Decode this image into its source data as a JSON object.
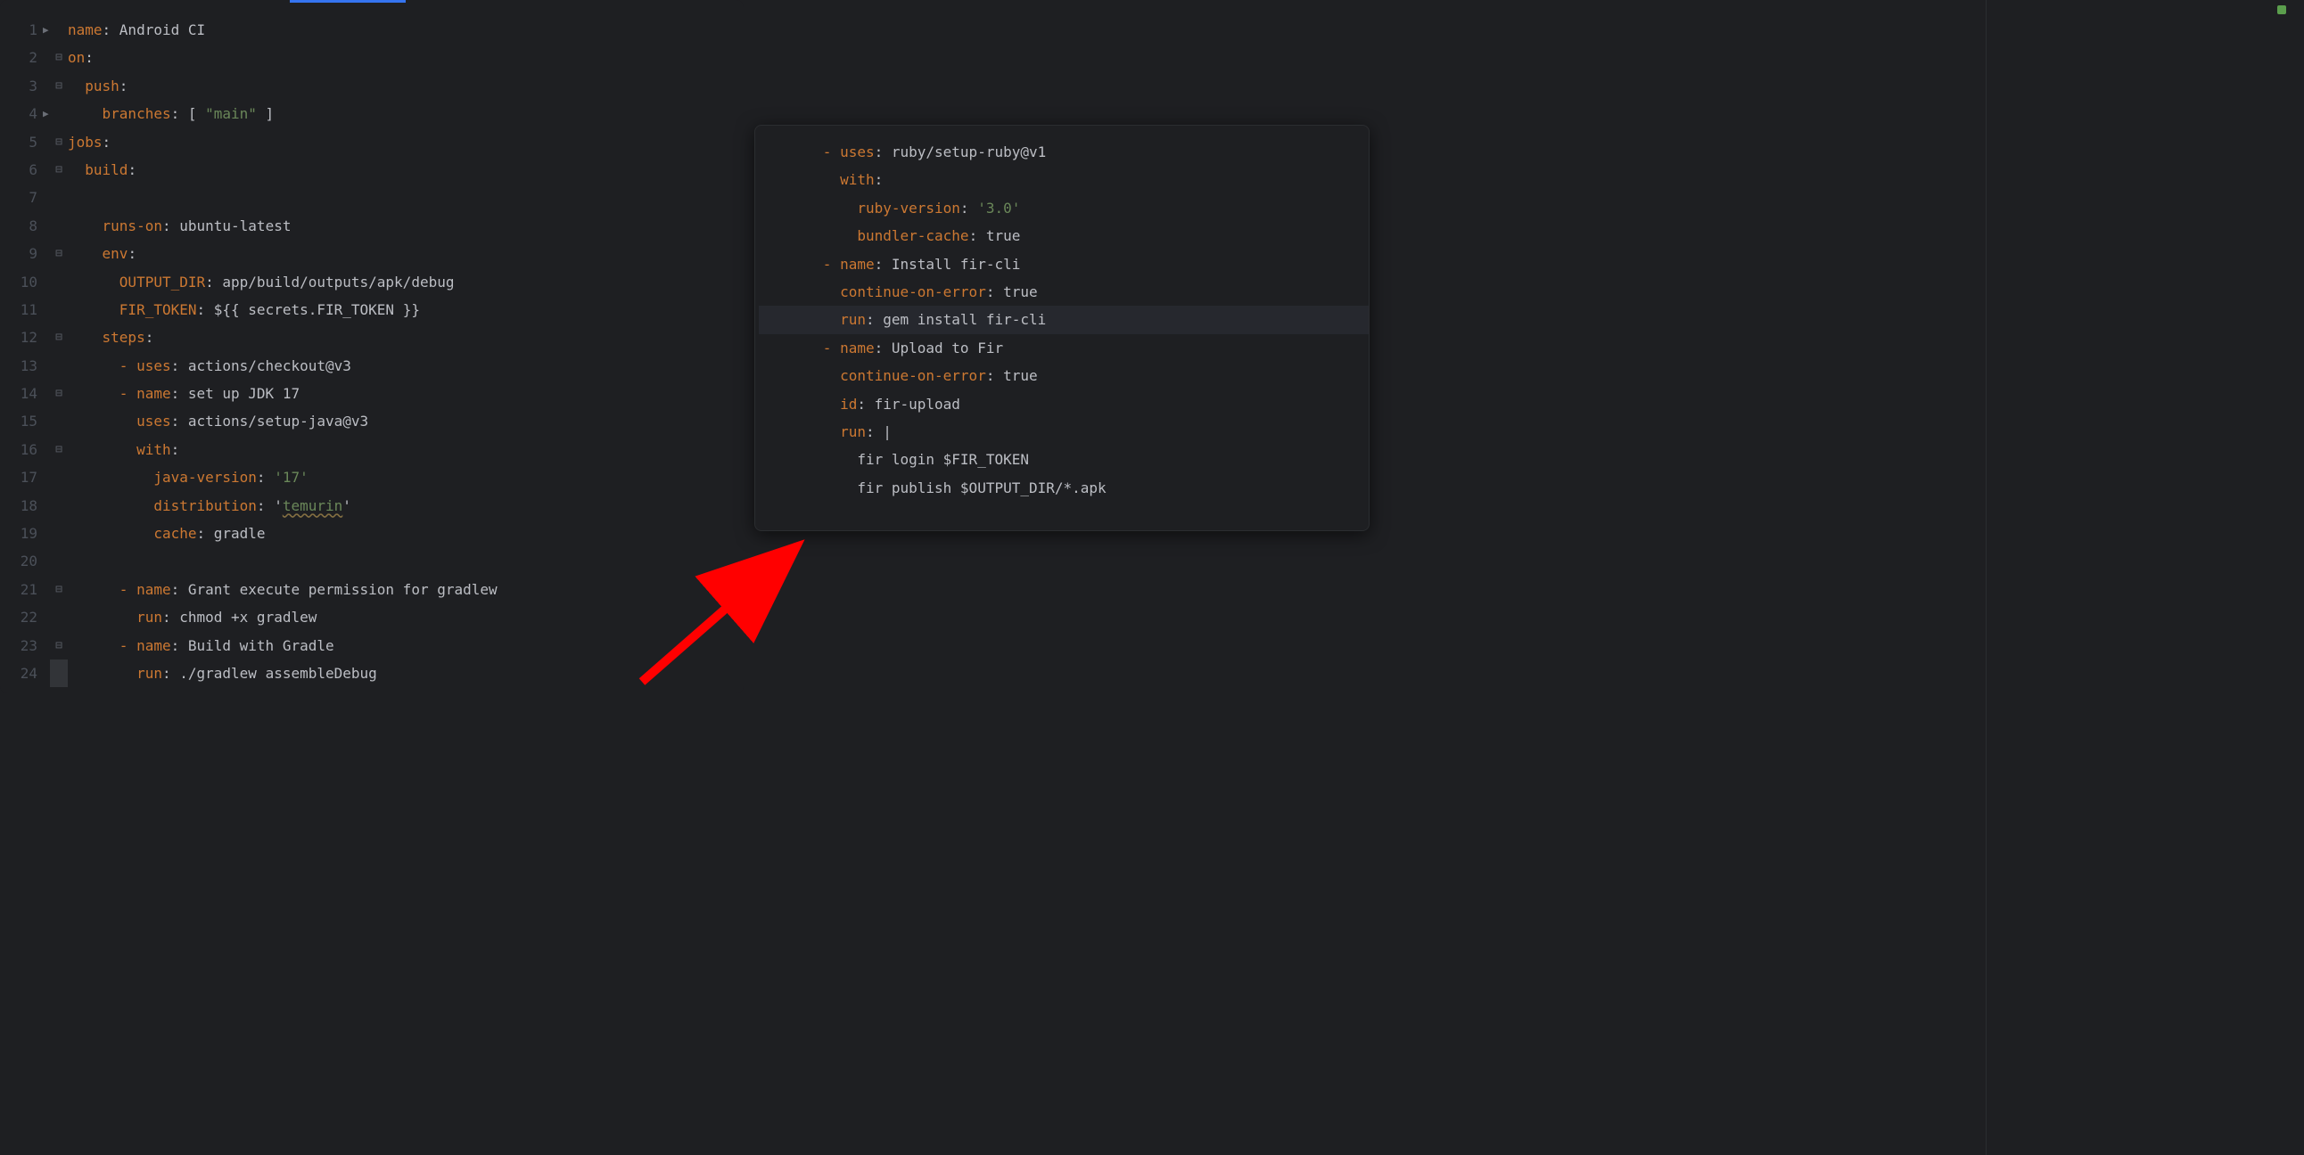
{
  "left": {
    "lines": [
      {
        "n": "1",
        "fold": "tri",
        "tokens": [
          {
            "c": "tk-key",
            "t": "name"
          },
          {
            "c": "tk-pun",
            "t": ": "
          },
          {
            "c": "tk-txt",
            "t": "Android CI"
          }
        ]
      },
      {
        "n": "2",
        "fold": "minus",
        "tokens": [
          {
            "c": "tk-key",
            "t": "on"
          },
          {
            "c": "tk-pun",
            "t": ":"
          }
        ]
      },
      {
        "n": "3",
        "fold": "minus",
        "tokens": [
          {
            "c": "tk-txt",
            "t": "  "
          },
          {
            "c": "tk-key",
            "t": "push"
          },
          {
            "c": "tk-pun",
            "t": ":"
          }
        ]
      },
      {
        "n": "4",
        "fold": "tri",
        "tokens": [
          {
            "c": "tk-txt",
            "t": "    "
          },
          {
            "c": "tk-key",
            "t": "branches"
          },
          {
            "c": "tk-pun",
            "t": ": [ "
          },
          {
            "c": "tk-str",
            "t": "\"main\""
          },
          {
            "c": "tk-pun",
            "t": " ]"
          }
        ]
      },
      {
        "n": "5",
        "fold": "minus",
        "tokens": [
          {
            "c": "tk-key",
            "t": "jobs"
          },
          {
            "c": "tk-pun",
            "t": ":"
          }
        ]
      },
      {
        "n": "6",
        "fold": "minus",
        "tokens": [
          {
            "c": "tk-txt",
            "t": "  "
          },
          {
            "c": "tk-key",
            "t": "build"
          },
          {
            "c": "tk-pun",
            "t": ":"
          }
        ]
      },
      {
        "n": "7",
        "fold": "",
        "tokens": []
      },
      {
        "n": "8",
        "fold": "",
        "tokens": [
          {
            "c": "tk-txt",
            "t": "    "
          },
          {
            "c": "tk-key",
            "t": "runs-on"
          },
          {
            "c": "tk-pun",
            "t": ": "
          },
          {
            "c": "tk-txt",
            "t": "ubuntu-latest"
          }
        ]
      },
      {
        "n": "9",
        "fold": "minus",
        "tokens": [
          {
            "c": "tk-txt",
            "t": "    "
          },
          {
            "c": "tk-key",
            "t": "env"
          },
          {
            "c": "tk-pun",
            "t": ":"
          }
        ]
      },
      {
        "n": "10",
        "fold": "",
        "tokens": [
          {
            "c": "tk-txt",
            "t": "      "
          },
          {
            "c": "tk-key",
            "t": "OUTPUT_DIR"
          },
          {
            "c": "tk-pun",
            "t": ": "
          },
          {
            "c": "tk-txt",
            "t": "app/build/outputs/apk/debug"
          }
        ]
      },
      {
        "n": "11",
        "fold": "",
        "tokens": [
          {
            "c": "tk-txt",
            "t": "      "
          },
          {
            "c": "tk-key",
            "t": "FIR_TOKEN"
          },
          {
            "c": "tk-pun",
            "t": ": "
          },
          {
            "c": "tk-txt",
            "t": "${{ secrets.FIR_TOKEN }}"
          }
        ]
      },
      {
        "n": "12",
        "fold": "minus",
        "tokens": [
          {
            "c": "tk-txt",
            "t": "    "
          },
          {
            "c": "tk-key",
            "t": "steps"
          },
          {
            "c": "tk-pun",
            "t": ":"
          }
        ]
      },
      {
        "n": "13",
        "fold": "",
        "tokens": [
          {
            "c": "tk-txt",
            "t": "      "
          },
          {
            "c": "tk-dash",
            "t": "- "
          },
          {
            "c": "tk-key",
            "t": "uses"
          },
          {
            "c": "tk-pun",
            "t": ": "
          },
          {
            "c": "tk-txt",
            "t": "actions/checkout@v3"
          }
        ]
      },
      {
        "n": "14",
        "fold": "minus",
        "tokens": [
          {
            "c": "tk-txt",
            "t": "      "
          },
          {
            "c": "tk-dash",
            "t": "- "
          },
          {
            "c": "tk-key",
            "t": "name"
          },
          {
            "c": "tk-pun",
            "t": ": "
          },
          {
            "c": "tk-txt",
            "t": "set up JDK 17"
          }
        ]
      },
      {
        "n": "15",
        "fold": "",
        "tokens": [
          {
            "c": "tk-txt",
            "t": "        "
          },
          {
            "c": "tk-key",
            "t": "uses"
          },
          {
            "c": "tk-pun",
            "t": ": "
          },
          {
            "c": "tk-txt",
            "t": "actions/setup-java@v3"
          }
        ]
      },
      {
        "n": "16",
        "fold": "minus",
        "tokens": [
          {
            "c": "tk-txt",
            "t": "        "
          },
          {
            "c": "tk-key",
            "t": "with"
          },
          {
            "c": "tk-pun",
            "t": ":"
          }
        ]
      },
      {
        "n": "17",
        "fold": "",
        "tokens": [
          {
            "c": "tk-txt",
            "t": "          "
          },
          {
            "c": "tk-key",
            "t": "java-version"
          },
          {
            "c": "tk-pun",
            "t": ": "
          },
          {
            "c": "tk-str",
            "t": "'17'"
          }
        ]
      },
      {
        "n": "18",
        "fold": "",
        "tokens": [
          {
            "c": "tk-txt",
            "t": "          "
          },
          {
            "c": "tk-key",
            "t": "distribution"
          },
          {
            "c": "tk-pun",
            "t": ": '"
          },
          {
            "c": "tk-warn",
            "t": "temurin"
          },
          {
            "c": "tk-pun",
            "t": "'"
          }
        ]
      },
      {
        "n": "19",
        "fold": "",
        "tokens": [
          {
            "c": "tk-txt",
            "t": "          "
          },
          {
            "c": "tk-key",
            "t": "cache"
          },
          {
            "c": "tk-pun",
            "t": ": "
          },
          {
            "c": "tk-txt",
            "t": "gradle"
          }
        ]
      },
      {
        "n": "20",
        "fold": "",
        "tokens": []
      },
      {
        "n": "21",
        "fold": "minus",
        "tokens": [
          {
            "c": "tk-txt",
            "t": "      "
          },
          {
            "c": "tk-dash",
            "t": "- "
          },
          {
            "c": "tk-key",
            "t": "name"
          },
          {
            "c": "tk-pun",
            "t": ": "
          },
          {
            "c": "tk-txt",
            "t": "Grant execute permission for gradlew"
          }
        ]
      },
      {
        "n": "22",
        "fold": "",
        "tokens": [
          {
            "c": "tk-txt",
            "t": "        "
          },
          {
            "c": "tk-key",
            "t": "run"
          },
          {
            "c": "tk-pun",
            "t": ": "
          },
          {
            "c": "tk-txt",
            "t": "chmod +x gradlew"
          }
        ]
      },
      {
        "n": "23",
        "fold": "minus",
        "tokens": [
          {
            "c": "tk-txt",
            "t": "      "
          },
          {
            "c": "tk-dash",
            "t": "- "
          },
          {
            "c": "tk-key",
            "t": "name"
          },
          {
            "c": "tk-pun",
            "t": ": "
          },
          {
            "c": "tk-txt",
            "t": "Build with Gradle"
          }
        ]
      },
      {
        "n": "24",
        "fold": "bar",
        "tokens": [
          {
            "c": "tk-txt",
            "t": "        "
          },
          {
            "c": "tk-key",
            "t": "run"
          },
          {
            "c": "tk-pun",
            "t": ": "
          },
          {
            "c": "tk-txt",
            "t": "./gradlew assembleDebug"
          }
        ]
      }
    ]
  },
  "right": {
    "lines": [
      {
        "hl": false,
        "tokens": [
          {
            "c": "tk-txt",
            "t": "      "
          },
          {
            "c": "tk-dash",
            "t": "- "
          },
          {
            "c": "tk-key",
            "t": "uses"
          },
          {
            "c": "tk-pun",
            "t": ": "
          },
          {
            "c": "tk-txt",
            "t": "ruby/setup-ruby@v1"
          }
        ]
      },
      {
        "hl": false,
        "tokens": [
          {
            "c": "tk-txt",
            "t": "        "
          },
          {
            "c": "tk-key",
            "t": "with"
          },
          {
            "c": "tk-pun",
            "t": ":"
          }
        ]
      },
      {
        "hl": false,
        "tokens": [
          {
            "c": "tk-txt",
            "t": "          "
          },
          {
            "c": "tk-key",
            "t": "ruby-version"
          },
          {
            "c": "tk-pun",
            "t": ": "
          },
          {
            "c": "tk-str",
            "t": "'3.0'"
          }
        ]
      },
      {
        "hl": false,
        "tokens": [
          {
            "c": "tk-txt",
            "t": "          "
          },
          {
            "c": "tk-key",
            "t": "bundler-cache"
          },
          {
            "c": "tk-pun",
            "t": ": "
          },
          {
            "c": "tk-txt",
            "t": "true"
          }
        ]
      },
      {
        "hl": false,
        "tokens": [
          {
            "c": "tk-txt",
            "t": "      "
          },
          {
            "c": "tk-dash",
            "t": "- "
          },
          {
            "c": "tk-key",
            "t": "name"
          },
          {
            "c": "tk-pun",
            "t": ": "
          },
          {
            "c": "tk-txt",
            "t": "Install fir-cli"
          }
        ]
      },
      {
        "hl": false,
        "tokens": [
          {
            "c": "tk-txt",
            "t": "        "
          },
          {
            "c": "tk-key",
            "t": "continue-on-error"
          },
          {
            "c": "tk-pun",
            "t": ": "
          },
          {
            "c": "tk-txt",
            "t": "true"
          }
        ]
      },
      {
        "hl": true,
        "tokens": [
          {
            "c": "tk-txt",
            "t": "        "
          },
          {
            "c": "tk-key",
            "t": "run"
          },
          {
            "c": "tk-pun",
            "t": ": "
          },
          {
            "c": "tk-txt",
            "t": "gem install fir-cli"
          }
        ]
      },
      {
        "hl": false,
        "tokens": [
          {
            "c": "tk-txt",
            "t": "      "
          },
          {
            "c": "tk-dash",
            "t": "- "
          },
          {
            "c": "tk-key",
            "t": "name"
          },
          {
            "c": "tk-pun",
            "t": ": "
          },
          {
            "c": "tk-txt",
            "t": "Upload to Fir"
          }
        ]
      },
      {
        "hl": false,
        "tokens": [
          {
            "c": "tk-txt",
            "t": "        "
          },
          {
            "c": "tk-key",
            "t": "continue-on-error"
          },
          {
            "c": "tk-pun",
            "t": ": "
          },
          {
            "c": "tk-txt",
            "t": "true"
          }
        ]
      },
      {
        "hl": false,
        "tokens": [
          {
            "c": "tk-txt",
            "t": "        "
          },
          {
            "c": "tk-key",
            "t": "id"
          },
          {
            "c": "tk-pun",
            "t": ": "
          },
          {
            "c": "tk-txt",
            "t": "fir-upload"
          }
        ]
      },
      {
        "hl": false,
        "tokens": [
          {
            "c": "tk-txt",
            "t": "        "
          },
          {
            "c": "tk-key",
            "t": "run"
          },
          {
            "c": "tk-pun",
            "t": ": |"
          }
        ]
      },
      {
        "hl": false,
        "tokens": [
          {
            "c": "tk-txt",
            "t": "          fir login $FIR_TOKEN"
          }
        ]
      },
      {
        "hl": false,
        "tokens": [
          {
            "c": "tk-txt",
            "t": "          fir publish $OUTPUT_DIR/*.apk"
          }
        ]
      }
    ]
  }
}
